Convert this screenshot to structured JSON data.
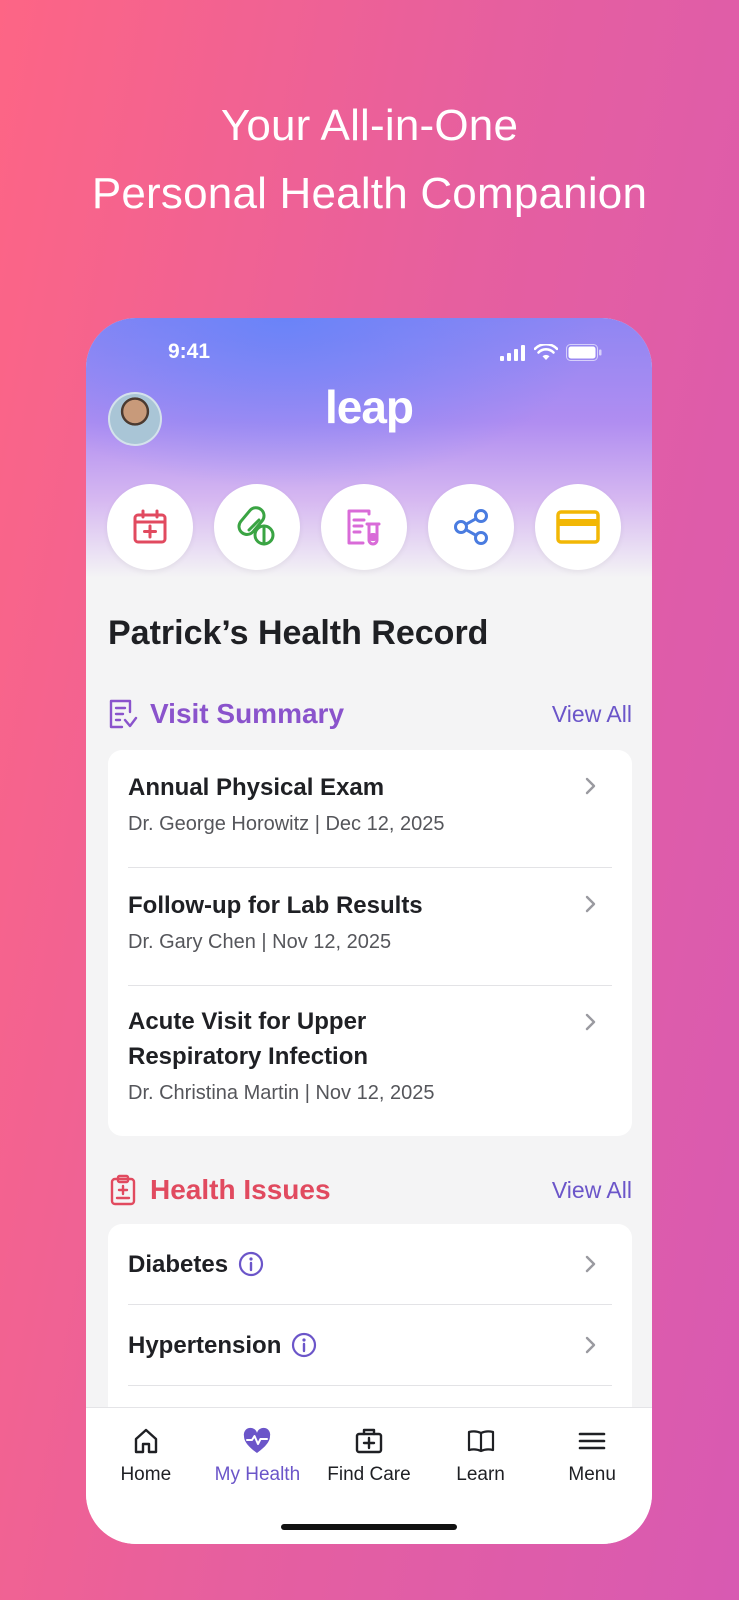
{
  "headline": {
    "line1": "Your All-in-One",
    "line2": "Personal Health Companion"
  },
  "status": {
    "time": "9:41"
  },
  "brand": {
    "logo_text": "leap"
  },
  "quick_actions": [
    {
      "icon": "calendar-plus-icon",
      "color": "#e14a5f"
    },
    {
      "icon": "pills-icon",
      "color": "#3aa443"
    },
    {
      "icon": "lab-report-icon",
      "color": "#d96bd8"
    },
    {
      "icon": "share-icon",
      "color": "#4a7ce0"
    },
    {
      "icon": "card-icon",
      "color": "#f2b705"
    }
  ],
  "record_title": "Patrick’s Health Record",
  "visit_summary": {
    "title": "Visit Summary",
    "view_all": "View All",
    "color": "#8a53cc",
    "items": [
      {
        "title": "Annual Physical Exam",
        "subtitle": "Dr. George Horowitz | Dec 12, 2025"
      },
      {
        "title": "Follow-up for Lab Results",
        "subtitle": "Dr. Gary Chen | Nov 12, 2025"
      },
      {
        "title": "Acute Visit for Upper Respiratory Infection",
        "subtitle": "Dr. Christina Martin | Nov 12, 2025"
      }
    ]
  },
  "health_issues": {
    "title": "Health Issues",
    "view_all": "View All",
    "color": "#e14a5f",
    "items": [
      {
        "title": "Diabetes"
      },
      {
        "title": "Hypertension"
      }
    ]
  },
  "tabbar": {
    "active_color": "#6b55c9",
    "items": [
      {
        "label": "Home",
        "icon": "home-icon"
      },
      {
        "label": "My Health",
        "icon": "heart-pulse-icon"
      },
      {
        "label": "Find Care",
        "icon": "medical-bag-icon"
      },
      {
        "label": "Learn",
        "icon": "book-icon"
      },
      {
        "label": "Menu",
        "icon": "menu-icon"
      }
    ]
  }
}
